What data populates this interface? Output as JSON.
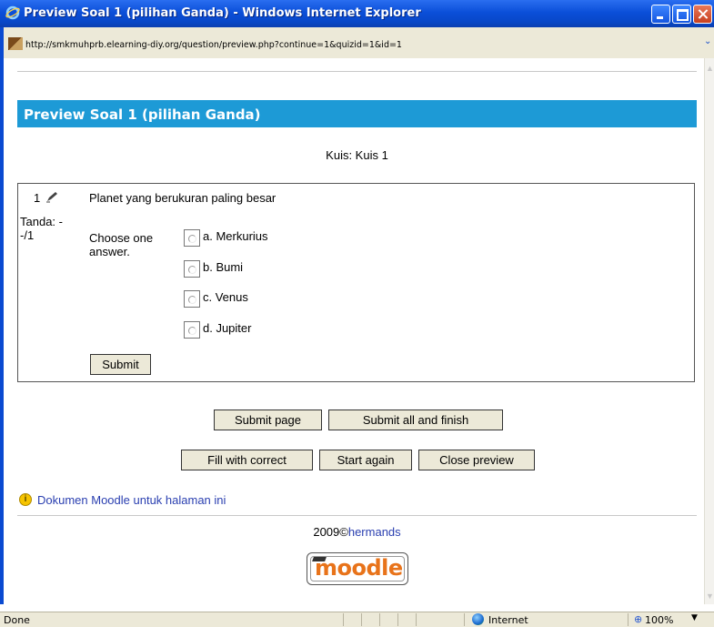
{
  "window": {
    "title": "Preview Soal 1 (pilihan Ganda) - Windows Internet Explorer",
    "url": "http://smkmuhprb.elearning-diy.org/question/preview.php?continue=1&quizid=1&id=1"
  },
  "page": {
    "heading": "Preview Soal 1 (pilihan Ganda)",
    "quiz_label": "Kuis: Kuis 1"
  },
  "question": {
    "number": "1",
    "text": "Planet yang berukuran paling besar",
    "mark": "Tanda: --/1",
    "prompt": "Choose one answer.",
    "options": [
      "a. Merkurius",
      "b. Bumi",
      "c. Venus",
      "d. Jupiter"
    ],
    "submit_label": "Submit"
  },
  "actions": {
    "submit_page": "Submit page",
    "submit_all": "Submit all and finish",
    "fill_correct": "Fill with correct",
    "start_again": "Start again",
    "close_preview": "Close preview"
  },
  "footer": {
    "doc_link": "Dokumen Moodle untuk halaman ini",
    "copyright_prefix": "2009©",
    "copyright_author": "hermands",
    "logo_text": "moodle"
  },
  "statusbar": {
    "status": "Done",
    "zone": "Internet",
    "zoom": "100%"
  }
}
